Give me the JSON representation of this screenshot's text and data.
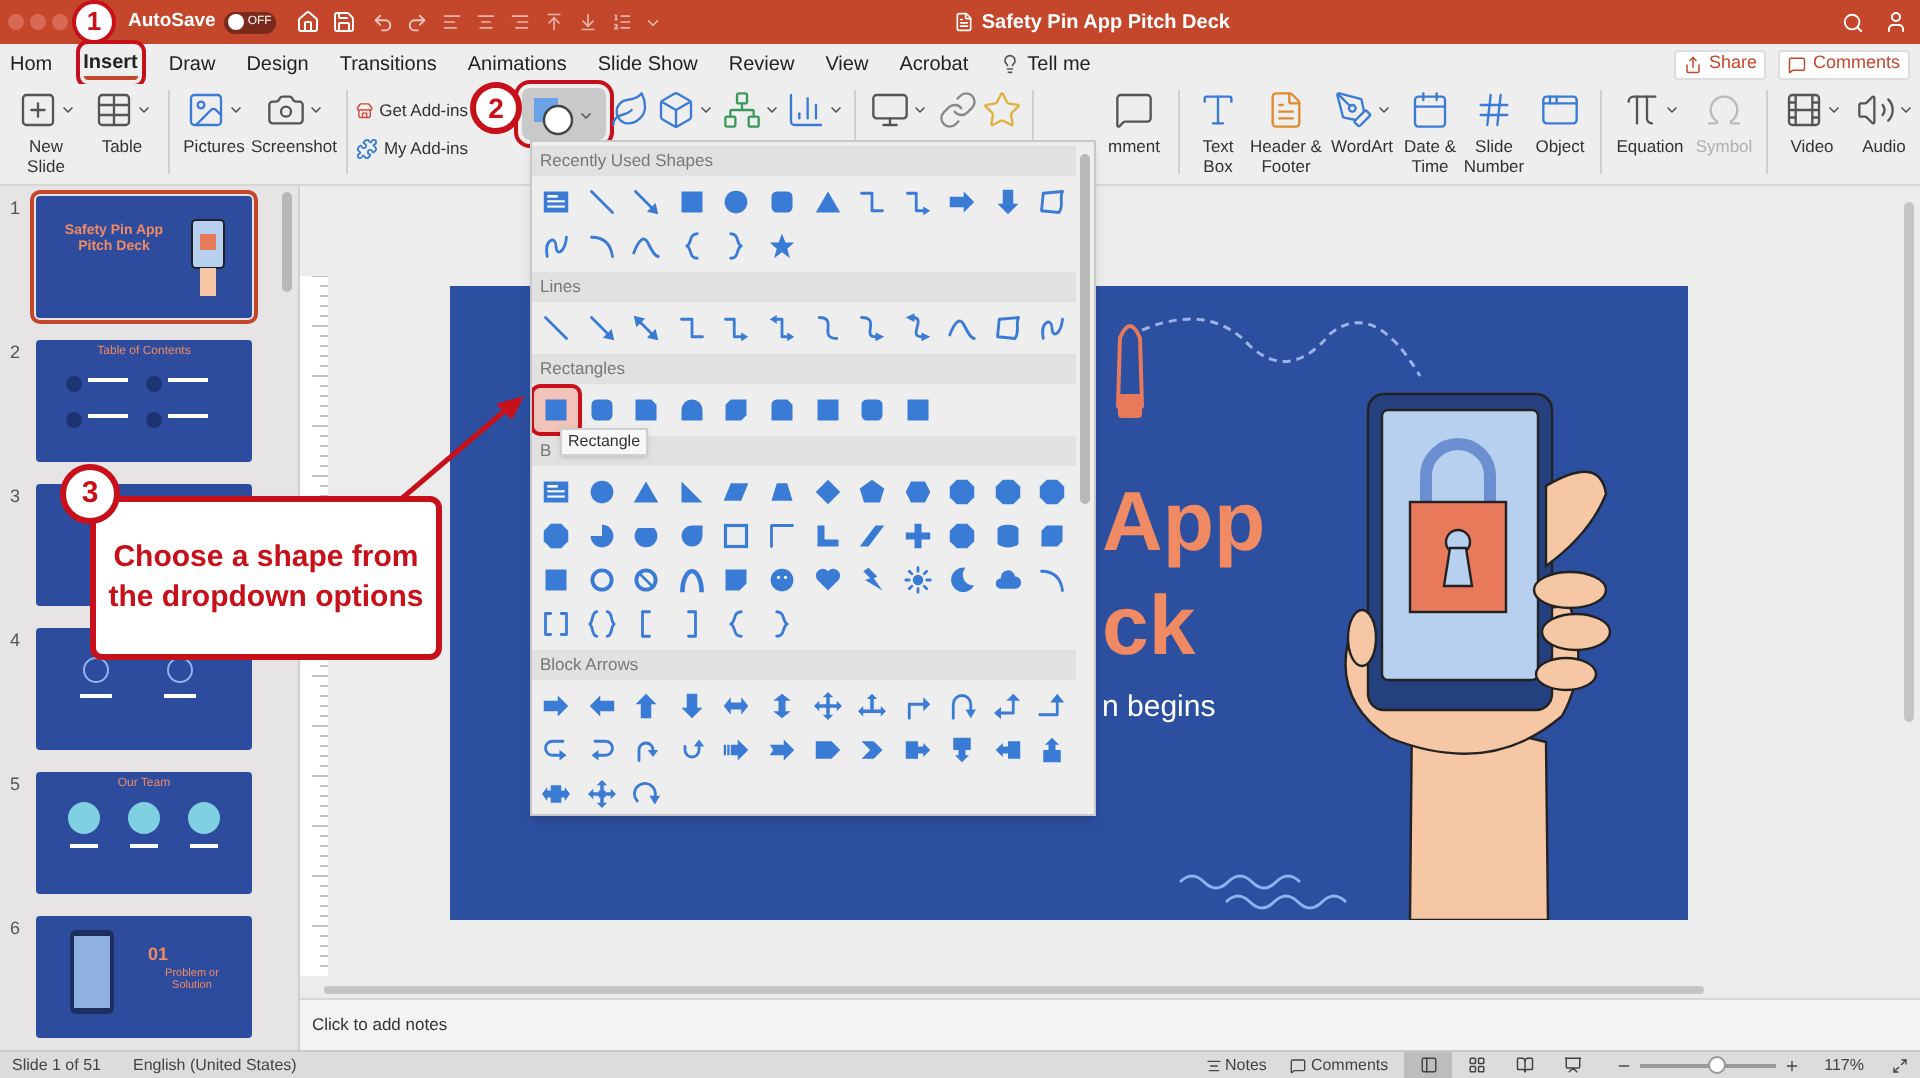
{
  "title_bar": {
    "autosave": {
      "label": "AutoSave",
      "state_text": "OFF",
      "on": false
    },
    "title": "Safety Pin App Pitch Deck"
  },
  "tabs": [
    {
      "label": "Hom",
      "selected": false
    },
    {
      "label": "Insert",
      "selected": true
    },
    {
      "label": "Draw",
      "selected": false
    },
    {
      "label": "Design",
      "selected": false
    },
    {
      "label": "Transitions",
      "selected": false
    },
    {
      "label": "Animations",
      "selected": false
    },
    {
      "label": "Slide Show",
      "selected": false
    },
    {
      "label": "Review",
      "selected": false
    },
    {
      "label": "View",
      "selected": false
    },
    {
      "label": "Acrobat",
      "selected": false
    }
  ],
  "tell_me": "Tell me",
  "share_button": "Share",
  "comments_button": "Comments",
  "ribbon_groups": [
    {
      "items": [
        {
          "kind": "new-slide",
          "label": "New Slide",
          "pressed": false,
          "disabled": false
        },
        {
          "kind": "table",
          "label": "Table",
          "pressed": false,
          "disabled": false
        }
      ]
    },
    {
      "items": [
        {
          "kind": "pictures",
          "label": "Pictures",
          "pressed": false,
          "disabled": false
        },
        {
          "kind": "screenshot",
          "label": "Screenshot",
          "pressed": false,
          "disabled": false
        }
      ]
    },
    {
      "stacked_items": [
        {
          "kind": "get-addins",
          "label": "Get Add-ins",
          "pressed": false,
          "disabled": false
        },
        {
          "kind": "my-addins",
          "label": "My Add-ins",
          "pressed": false,
          "disabled": false
        }
      ]
    },
    {
      "items": [
        {
          "kind": "shapes",
          "pressed": true,
          "disabled": false
        },
        {
          "kind": "icons",
          "pressed": false,
          "disabled": false
        },
        {
          "kind": "models",
          "pressed": false,
          "disabled": false
        },
        {
          "kind": "smartart",
          "pressed": false,
          "disabled": false
        },
        {
          "kind": "chart",
          "pressed": false,
          "disabled": false
        }
      ]
    },
    {
      "items": [
        {
          "kind": "screen-recording",
          "pressed": false,
          "disabled": false
        },
        {
          "kind": "link",
          "pressed": false,
          "disabled": false
        },
        {
          "kind": "action",
          "pressed": false,
          "disabled": false
        }
      ]
    },
    {
      "items": [
        {
          "kind": "comment",
          "label": "mment",
          "pressed": false,
          "disabled": false
        }
      ]
    },
    {
      "items": [
        {
          "kind": "text-box",
          "label": "Text Box",
          "pressed": false,
          "disabled": false
        },
        {
          "kind": "header-footer",
          "label": "Header & Footer",
          "pressed": false,
          "disabled": false
        },
        {
          "kind": "wordart",
          "label": "WordArt",
          "pressed": false,
          "disabled": false
        },
        {
          "kind": "date-time",
          "label": "Date & Time",
          "pressed": false,
          "disabled": false
        },
        {
          "kind": "slide-number",
          "label": "Slide Number",
          "pressed": false,
          "disabled": false
        },
        {
          "kind": "object",
          "label": "Object",
          "pressed": false,
          "disabled": false
        }
      ]
    },
    {
      "items": [
        {
          "kind": "equation",
          "label": "Equation",
          "pressed": false,
          "disabled": false
        },
        {
          "kind": "symbol",
          "label": "Symbol",
          "pressed": false,
          "disabled": true
        }
      ]
    },
    {
      "items": [
        {
          "kind": "video",
          "label": "Video",
          "pressed": false,
          "disabled": false
        },
        {
          "kind": "audio",
          "label": "Audio",
          "pressed": false,
          "disabled": false
        }
      ]
    }
  ],
  "slides": [
    {
      "number": "1",
      "selected": true,
      "kind": "title",
      "title": "Safety Pin App Pitch Deck"
    },
    {
      "number": "2",
      "selected": false,
      "kind": "contents",
      "title": "Table of Contents"
    },
    {
      "number": "3",
      "selected": false,
      "kind": "blank"
    },
    {
      "number": "4",
      "selected": false,
      "kind": "two-icons"
    },
    {
      "number": "5",
      "selected": false,
      "kind": "team",
      "title": "Our Team"
    },
    {
      "number": "6",
      "selected": false,
      "kind": "phone",
      "title": "01",
      "subtitle": "Problem or Solution"
    }
  ],
  "slide": {
    "title_lines": [
      "App",
      "ck"
    ],
    "subtitle": "n begins"
  },
  "shapes_menu": {
    "sections": [
      {
        "title": "Recently Used Shapes"
      },
      {
        "title": "Lines"
      },
      {
        "title": "Rectangles",
        "shapes": [
          {
            "selected": true
          },
          {
            "selected": false
          },
          {
            "selected": false
          },
          {
            "selected": false
          },
          {
            "selected": false
          },
          {
            "selected": false
          },
          {
            "selected": false
          },
          {
            "selected": false
          },
          {
            "selected": false
          }
        ]
      },
      {
        "title": "B"
      },
      {
        "title": "Block Arrows"
      }
    ],
    "tooltip": "Rectangle"
  },
  "notes_placeholder": "Click to add notes",
  "status_bar": {
    "slide_count": "Slide 1 of 51",
    "language": "English (United States)",
    "notes": "Notes",
    "comments": "Comments",
    "views": [
      {
        "selected": true
      },
      {
        "selected": false
      },
      {
        "selected": false
      },
      {
        "selected": false
      }
    ],
    "zoom": {
      "level": 0.55
    },
    "zoom_text": "117%"
  },
  "annotations": [
    {
      "number": "1"
    },
    {
      "number": "2"
    },
    {
      "number": "3",
      "text": "Choose a shape from the dropdown options"
    }
  ]
}
